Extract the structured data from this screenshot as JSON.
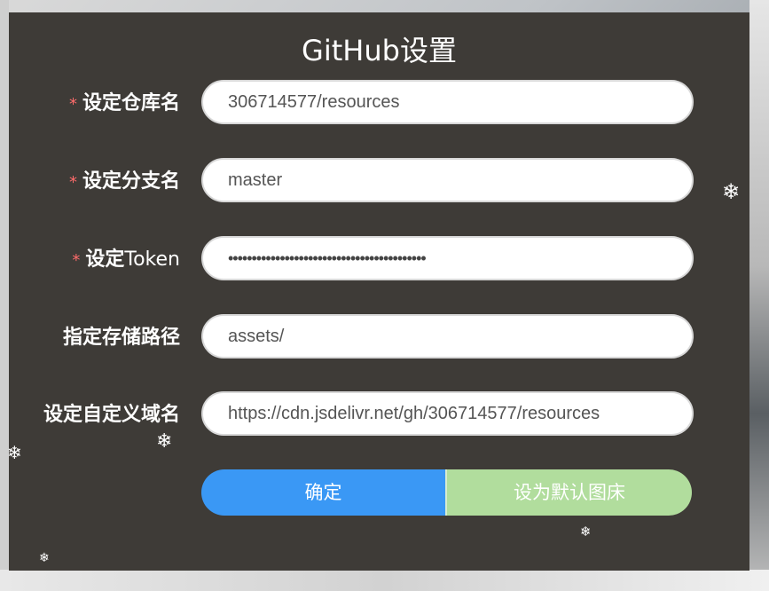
{
  "dialog": {
    "title": "GitHub设置",
    "fields": [
      {
        "required": "*",
        "label": "设定仓库名",
        "value": "306714577/resources"
      },
      {
        "required": "*",
        "label": "设定分支名",
        "value": "master"
      },
      {
        "required": "*",
        "label_cn": "设定",
        "label_en": "Token",
        "value": "••••••••••••••••••••••••••••••••••••••••••"
      },
      {
        "label": "指定存储路径",
        "value": "assets/"
      },
      {
        "label": "设定自定义域名",
        "value": "https://cdn.jsdelivr.net/gh/306714577/resources"
      }
    ],
    "buttons": {
      "confirm": "确定",
      "set_default": "设为默认图床"
    }
  },
  "decor": {
    "snowflake_icon": "❄",
    "colors": {
      "panel": "#3e3b37",
      "required": "#ff6b6b",
      "confirm": "#3a98f5",
      "default": "#b1dd9d"
    }
  }
}
